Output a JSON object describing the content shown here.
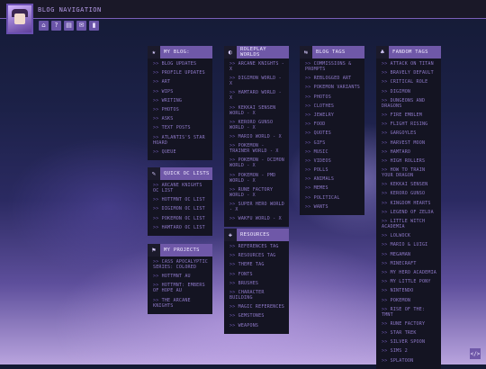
{
  "header": {
    "title": "BLOG NAVIGATION"
  },
  "nav_icons": [
    {
      "name": "home-icon",
      "glyph": "⌂"
    },
    {
      "name": "help-icon",
      "glyph": "?"
    },
    {
      "name": "page-icon",
      "glyph": "▤"
    },
    {
      "name": "mail-icon",
      "glyph": "✉"
    },
    {
      "name": "bookmark-icon",
      "glyph": "▮"
    }
  ],
  "boxes": {
    "my_blog": {
      "title": "MY BLOG:",
      "icon": "★",
      "items": [
        "BLOG UPDATES",
        "PROFILE UPDATES",
        "ART",
        "WIPS",
        "WRITING",
        "PHOTOS",
        "ASKS",
        "TEXT POSTS",
        "ATLANTIS'S STAR HOARD",
        "QUEUE"
      ]
    },
    "quick_oc": {
      "title": "QUICK OC LISTS",
      "icon": "✎",
      "items": [
        "ARCANE KNIGHTS OC LIST",
        "HOTTMNT OC LIST",
        "DIGIMON OC LIST",
        "POKEMON OC LIST",
        "HAMTARO OC LIST"
      ]
    },
    "my_projects": {
      "title": "MY PROJECTS",
      "icon": "⚑",
      "items": [
        "CASS APOCALYPTIC SERIES: COLORED",
        "HOTTMNT AU",
        "HOTTMNT: EMBERS OF HOPE AU",
        "THE ARCANE KNIGHTS"
      ]
    },
    "roleplay": {
      "title": "ROLEPLAY WORLDS",
      "icon": "◐",
      "items": [
        "ARCANE KNIGHTS - X",
        "DIGIMON WORLD - X",
        "HAMTARO WORLD - X",
        "KEKKAI SENSEN WORLD - X",
        "KERORO GUNSO WORLD - X",
        "MARIO WORLD - X",
        "POKEMON - TRAINER WORLD - X",
        "POKEMON - OCIMON WORLD - X",
        "POKEMON - PMD WORLD - X",
        "RUNE FACTORY WORLD - X",
        "SUPER HERO WORLD - X",
        "WAKFU WORLD - X"
      ]
    },
    "resources": {
      "title": "RESOURCES",
      "icon": "✚",
      "items": [
        "REFERENCES TAG",
        "RESOURCES TAG",
        "THEME TAG",
        "FONTS",
        "BRUSHES",
        "CHARACTER BUILDING",
        "MAGIC REFERENCES",
        "GEMSTONES",
        "WEAPONS"
      ]
    },
    "blog_tags": {
      "title": "BLOG TAGS",
      "icon": "⇆",
      "items": [
        "COMMISSIONS & PROMPTS",
        "REBLOGGED ART",
        "POKEMON VARIANTS",
        "PHOTOS",
        "CLOTHES",
        "JEWELRY",
        "FOOD",
        "QUOTES",
        "GIFS",
        "MUSIC",
        "VIDEOS",
        "POLLS",
        "ANIMALS",
        "MEMES",
        "POLITICAL",
        "WANTS"
      ]
    },
    "fandom_tags": {
      "title": "FANDOM TAGS",
      "icon": "♣",
      "items": [
        "ATTACK ON TITAN",
        "BRAVELY DEFAULT",
        "CRITICAL ROLE",
        "DIGIMON",
        "DUNGEONS AND DRAGONS",
        "FIRE EMBLEM",
        "FLIGHT RISING",
        "GARGOYLES",
        "HARVEST MOON",
        "HAMTARO",
        "HIGH ROLLERS",
        "HOW TO TRAIN YOUR DRAGON",
        "KEKKAI SENSEN",
        "KERORO GUNSO",
        "KINGDOM HEARTS",
        "LEGEND OF ZELDA",
        "LITTLE WITCH ACADEMIA",
        "LOLWOCK",
        "MARIO & LUIGI",
        "MEGAMAN",
        "MINECRAFT",
        "MY HERO ACADEMIA",
        "MY LITTLE PONY",
        "NINTENDO",
        "POKEMON",
        "RISE OF THE: TMNT",
        "RUNE FACTORY",
        "STAR TREK",
        "SILVER SPOON",
        "SIMS 2",
        "SPLATOON"
      ]
    }
  },
  "scroll_button": {
    "label": "</>"
  }
}
